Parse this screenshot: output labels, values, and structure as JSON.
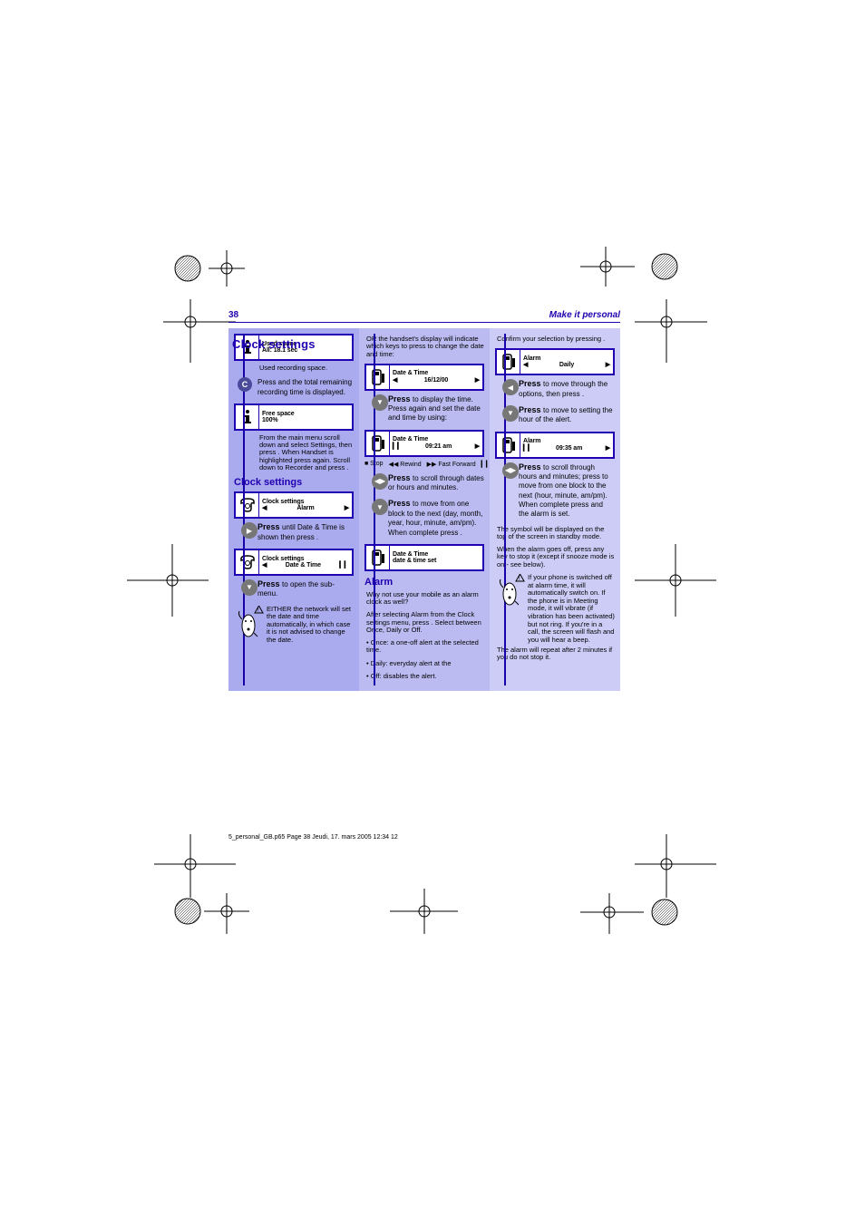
{
  "header": {
    "page_number": "38",
    "section": "Make it personal"
  },
  "title": "Clock settings",
  "legend": {
    "stop": "■ Stop",
    "rw": "◀◀ Rewind",
    "ff": "▶▶ Fast Forward",
    "pause": "▎▎ Pause"
  },
  "col1": {
    "screen1_line1": "Used space",
    "screen1_line2": "All: 18.1 sec",
    "caption1": "Used recording space.",
    "keyC_label": "C",
    "keyC_text": "Press and the total remaining recording time is displayed.",
    "screen2_line1": "Free space",
    "screen2_line2": "100%",
    "caption2": "From the main menu scroll down and select Settings, then press",
    "caption2b": ". When Handset is highlighted press     again. Scroll down to Recorder and press     .",
    "subhead": "Clock settings",
    "screen3_title": "Clock settings",
    "screen3_line2_left": "◀",
    "screen3_line2_mid": "Alarm",
    "screen3_line2_right": "▶",
    "step3_hd": "Press",
    "step3_tx": "until Date & Time is shown then press     .",
    "screen4_title": "Clock settings",
    "screen4_line2_left": "◀",
    "screen4_line2_mid": "Date & Time",
    "screen4_line2_right": "▎▎",
    "step4_hd": "Press",
    "step4_tx": "to open the sub-menu.",
    "note": "EITHER the network will set the date and time automatically, in which case it is not advised to change the date."
  },
  "col2": {
    "intro": "OR the handset's display will indicate which keys to press to change the date and time:",
    "screen1_title": "Date & Time",
    "screen1_line2_left": "◀",
    "screen1_line2_mid": "16/12/00",
    "screen1_line2_right": "▶",
    "step1_hd": "Press",
    "step1_tx": "to display the time. Press     again and set the date and time by using:",
    "screen2_title": "Date & Time",
    "screen2_line2_left": "▎▎",
    "screen2_line2_mid": "09:21 am",
    "screen2_line2_right": "▶",
    "step2a_hd": "Press",
    "step2a_tx": "to scroll through dates or hours and minutes.",
    "step2b_hd": "Press",
    "step2b_tx": "to move from one block to the next (day, month, year, hour, minute, am/pm). When complete press     .",
    "screen3_title": "Date & Time",
    "screen3_line2": "date & time set",
    "subhead": "Alarm",
    "p1": "Why not use your mobile as an alarm clock as well?",
    "p2": "After selecting Alarm from the Clock settings menu, press     . Select between Once, Daily or Off.",
    "p3": "• Once: a one-off alert at the selected time.",
    "p4": "• Daily: everyday alert at the",
    "p5": "• Off: disables the alert."
  },
  "col3": {
    "intro": "Confirm your selection by pressing     .",
    "screen1_title": "Alarm",
    "screen1_line2_left": "◀",
    "screen1_line2_mid": "Daily",
    "screen1_line2_right": "▶",
    "step1_hd": "Press",
    "step1_tx": "to move through the options, then press     .",
    "step2_hd": "Press",
    "step2_tx": "to move to setting the hour of the alert.",
    "screen2_title": "Alarm",
    "screen2_line2_left": "▎▎",
    "screen2_line2_mid": "09:35 am",
    "screen2_line2_right": "▶",
    "step3_hd": "Press",
    "step3_tx": "to scroll through hours and minutes; press     to move from one block to the next (hour, minute, am/pm). When complete press     and the alarm is set.",
    "p1": "The symbol     will be displayed on the top of the screen in standby mode.",
    "p2": "When the alarm goes off, press any key to stop it (except if snooze mode is on - see below).",
    "note": "If your phone is switched off at alarm time, it will automatically switch on. If the phone is in Meeting mode, it will vibrate (if vibration has been activated) but not ring. If you're in a call, the screen will flash and you will hear a beep.",
    "note2": "The alarm will repeat after 2 minutes if you do not stop it."
  },
  "footer": "5_personal_GB.p65  Page 38  Jeudi, 17. mars 2005  12:34 12"
}
